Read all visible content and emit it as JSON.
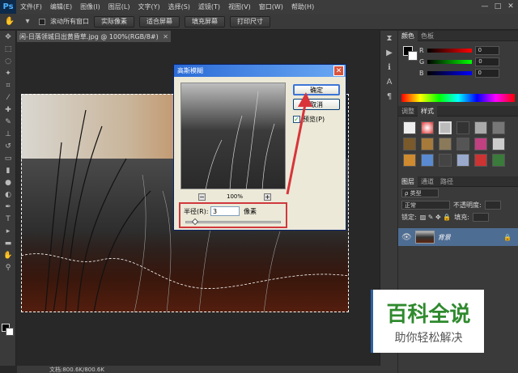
{
  "app": {
    "logo": "Ps"
  },
  "menu": [
    "文件(F)",
    "编辑(E)",
    "图像(I)",
    "图层(L)",
    "文字(Y)",
    "选择(S)",
    "滤镜(T)",
    "视图(V)",
    "窗口(W)",
    "帮助(H)"
  ],
  "window_controls": [
    "—",
    "□",
    "✕"
  ],
  "options": {
    "scroll_all_label": "滚动所有窗口",
    "actual_pixels": "实际像素",
    "fit_screen": "适合屏幕",
    "fill_screen": "填充屏幕",
    "print_size": "打印尺寸"
  },
  "document": {
    "tab": "闲-日落领城日出黄昏草.jpg @ 100%(RGB/8#)",
    "close": "✕"
  },
  "status": {
    "doc_info": "文档:800.6K/800.6K"
  },
  "dialog": {
    "title": "高斯模糊",
    "ok": "确定",
    "cancel": "取消",
    "preview_label": "预览(P)",
    "preview_checked": "✓",
    "zoom_out": "−",
    "zoom_level": "100%",
    "zoom_in": "+",
    "radius_label": "半径(R):",
    "radius_value": "3",
    "radius_unit": "像素",
    "slider_level": 0.1
  },
  "color_panel": {
    "tabs": [
      "颜色",
      "色板"
    ],
    "channels": [
      {
        "label": "R",
        "value": "0",
        "color": "#ff0000"
      },
      {
        "label": "G",
        "value": "0",
        "color": "#00ff00"
      },
      {
        "label": "B",
        "value": "0",
        "color": "#0000ff"
      }
    ]
  },
  "styles_panel": {
    "tabs": [
      "调整",
      "样式"
    ]
  },
  "layers_panel": {
    "tabs": [
      "图层",
      "通道",
      "路径"
    ],
    "kind": "ρ 类型",
    "blend_mode": "正常",
    "opacity_label": "不透明度:",
    "lock_label": "锁定:",
    "fill_label": "填充:",
    "layer_name": "背景"
  },
  "watermark": {
    "title": "百科全说",
    "subtitle": "助你轻松解决"
  }
}
